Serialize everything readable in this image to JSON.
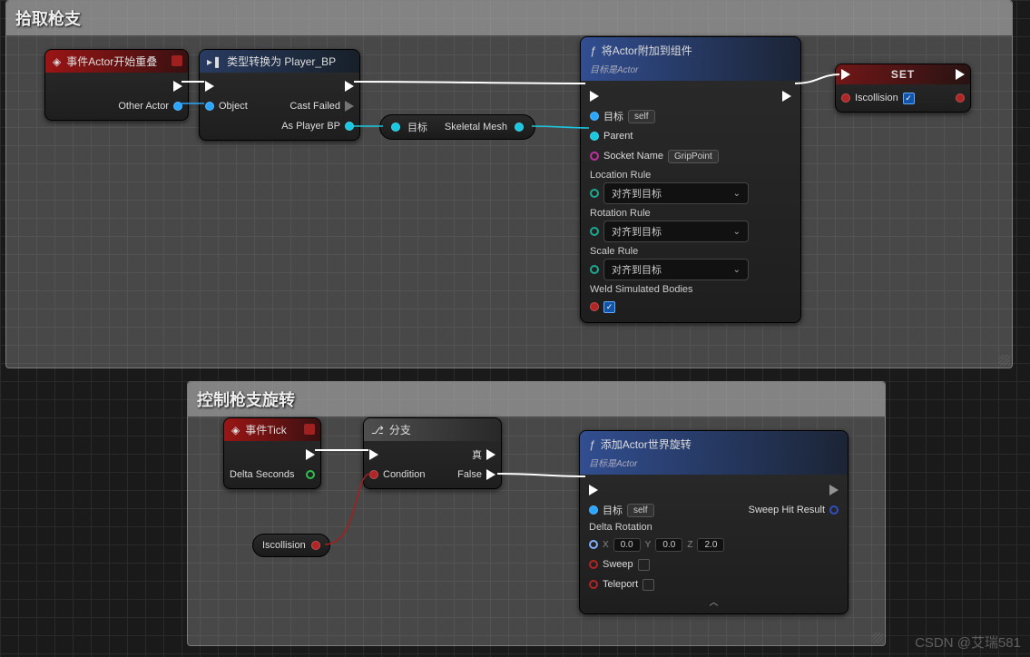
{
  "watermark": "CSDN @艾瑞581",
  "comment1": {
    "title": "拾取枪支"
  },
  "comment2": {
    "title": "控制枪支旋转"
  },
  "eventOverlap": {
    "title": "事件Actor开始重叠",
    "otherActor": "Other Actor"
  },
  "castNode": {
    "title": "类型转换为 Player_BP",
    "object": "Object",
    "castFailed": "Cast Failed",
    "asPlayerBP": "As Player BP"
  },
  "skelMeshPill": {
    "target": "目标",
    "output": "Skeletal Mesh"
  },
  "attachNode": {
    "title": "将Actor附加到组件",
    "subtitle": "目标是Actor",
    "target": "目标",
    "self": "self",
    "parent": "Parent",
    "socketName": "Socket Name",
    "socketValue": "GripPoint",
    "locationRule": "Location Rule",
    "locationValue": "对齐到目标",
    "rotationRule": "Rotation Rule",
    "rotationValue": "对齐到目标",
    "scaleRule": "Scale Rule",
    "scaleValue": "对齐到目标",
    "weld": "Weld Simulated Bodies"
  },
  "setNode": {
    "title": "SET",
    "var": "Iscollision"
  },
  "tickNode": {
    "title": "事件Tick",
    "delta": "Delta Seconds"
  },
  "branchNode": {
    "title": "分支",
    "condition": "Condition",
    "true": "真",
    "false": "False"
  },
  "isCollisionVar": {
    "name": "Iscollision"
  },
  "addRotNode": {
    "title": "添加Actor世界旋转",
    "subtitle": "目标是Actor",
    "target": "目标",
    "self": "self",
    "deltaRot": "Delta Rotation",
    "x": "0.0",
    "y": "0.0",
    "z": "2.0",
    "sweep": "Sweep",
    "teleport": "Teleport",
    "sweepResult": "Sweep Hit Result"
  }
}
